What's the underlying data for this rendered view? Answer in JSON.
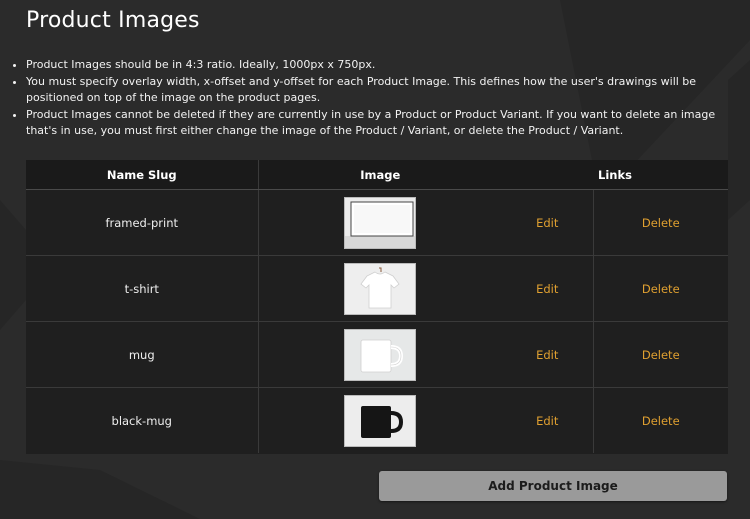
{
  "page": {
    "title": "Product Images",
    "notes": [
      "Product Images should be in 4:3 ratio. Ideally, 1000px x 750px.",
      "You must specify overlay width, x-offset and y-offset for each Product Image. This defines how the user's drawings will be positioned on top of the image on the product pages.",
      "Product Images cannot be deleted if they are currently in use by a Product or Product Variant. If you want to delete an image that's in use, you must first either change the image of the Product / Variant, or delete the Product / Variant."
    ]
  },
  "table": {
    "headers": {
      "slug": "Name Slug",
      "image": "Image",
      "links": "Links"
    },
    "rows": [
      {
        "slug": "framed-print",
        "image_icon": "framed-print-photo",
        "edit": "Edit",
        "delete": "Delete"
      },
      {
        "slug": "t-shirt",
        "image_icon": "white-tshirt-photo",
        "edit": "Edit",
        "delete": "Delete"
      },
      {
        "slug": "mug",
        "image_icon": "white-mug-photo",
        "edit": "Edit",
        "delete": "Delete"
      },
      {
        "slug": "black-mug",
        "image_icon": "black-mug-photo",
        "edit": "Edit",
        "delete": "Delete"
      }
    ]
  },
  "actions": {
    "add_label": "Add Product Image"
  },
  "colors": {
    "link": "#e0a030",
    "background": "#2b2b2b",
    "table": "#1f1f1f",
    "button": "#9a9a9a"
  }
}
